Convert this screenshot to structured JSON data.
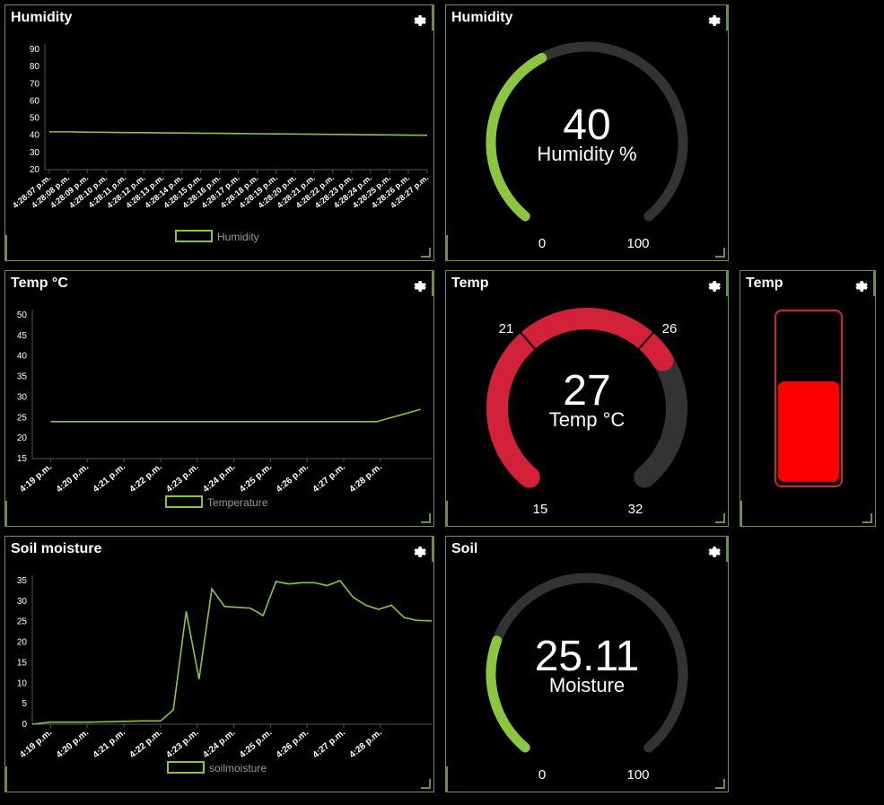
{
  "panels": {
    "humidity_chart": {
      "title": "Humidity"
    },
    "humidity_gauge": {
      "title": "Humidity",
      "value": "40",
      "unit": "Humidity %",
      "min": "0",
      "max": "100",
      "fraction": 0.4
    },
    "temp_chart": {
      "title": "Temp °C"
    },
    "temp_gauge": {
      "title": "Temp",
      "value": "27",
      "unit": "Temp °C",
      "min": "15",
      "max": "32",
      "mark1": "21",
      "mark2": "26",
      "fraction": 0.70588
    },
    "temp_tank": {
      "title": "Temp",
      "level": 0.6
    },
    "soil_chart": {
      "title": "Soil moisture"
    },
    "soil_gauge": {
      "title": "Soil",
      "value": "25.11",
      "unit": "Moisture",
      "min": "0",
      "max": "100",
      "fraction": 0.2511
    }
  },
  "colors": {
    "accent": "#8cc63f",
    "border": "#6a8f4a",
    "track": "#333333",
    "red": "#d4213a",
    "tank_red": "#ff0000"
  },
  "icons": {
    "settings": "gear-icon"
  },
  "chart_data": [
    {
      "type": "line",
      "legend": "Humidity",
      "x": [
        "4:28:07 p.m.",
        "4:28:08 p.m.",
        "4:28:09 p.m.",
        "4:28:10 p.m.",
        "4:28:11 p.m.",
        "4:28:12 p.m.",
        "4:28:13 p.m.",
        "4:28:14 p.m.",
        "4:28:15 p.m.",
        "4:28:16 p.m.",
        "4:28:17 p.m.",
        "4:28:18 p.m.",
        "4:28:19 p.m.",
        "4:28:20 p.m.",
        "4:28:21 p.m.",
        "4:28:22 p.m.",
        "4:28:23 p.m.",
        "4:28:24 p.m.",
        "4:28:25 p.m.",
        "4:28:26 p.m.",
        "4:28:27 p.m."
      ],
      "values": [
        42,
        42,
        41.8,
        41.7,
        41.6,
        41.5,
        41.4,
        41.3,
        41.2,
        41.1,
        41,
        40.9,
        40.8,
        40.7,
        40.6,
        40.5,
        40.4,
        40.3,
        40.2,
        40.1,
        40
      ],
      "yticks": [
        "20",
        "30",
        "40",
        "50",
        "60",
        "70",
        "80",
        "90"
      ],
      "ylim": [
        20,
        90
      ]
    },
    {
      "type": "line",
      "legend": "Temperature",
      "x": [
        "4:19 p.m.",
        "4:20 p.m.",
        "4:21 p.m.",
        "4:22 p.m.",
        "4:23 p.m.",
        "4:24 p.m.",
        "4:25 p.m.",
        "4:26 p.m.",
        "4:27 p.m.",
        "4:28 p.m."
      ],
      "points": [
        [
          0,
          24
        ],
        [
          1,
          24
        ],
        [
          2,
          24
        ],
        [
          3,
          24
        ],
        [
          4,
          24
        ],
        [
          5,
          24
        ],
        [
          6,
          24
        ],
        [
          7,
          24
        ],
        [
          8,
          24
        ],
        [
          8.9,
          24
        ],
        [
          9.3,
          25
        ],
        [
          9.7,
          26
        ],
        [
          10.1,
          27
        ]
      ],
      "yticks": [
        "15",
        "20",
        "25",
        "30",
        "35",
        "40",
        "45",
        "50"
      ],
      "ylim": [
        15,
        50
      ]
    },
    {
      "type": "line",
      "legend": "soilmoisture",
      "x": [
        "4:19 p.m.",
        "4:20 p.m.",
        "4:21 p.m.",
        "4:22 p.m.",
        "4:23 p.m.",
        "4:24 p.m.",
        "4:25 p.m.",
        "4:26 p.m.",
        "4:27 p.m.",
        "4:28 p.m."
      ],
      "points": [
        [
          -0.5,
          0
        ],
        [
          0,
          0.5
        ],
        [
          0.5,
          0.5
        ],
        [
          1,
          0.5
        ],
        [
          1.5,
          0.6
        ],
        [
          2,
          0.7
        ],
        [
          2.5,
          0.8
        ],
        [
          3,
          0.8
        ],
        [
          3.35,
          3.5
        ],
        [
          3.7,
          27.5
        ],
        [
          4.05,
          11
        ],
        [
          4.4,
          33
        ],
        [
          4.75,
          28.7
        ],
        [
          5.1,
          28.5
        ],
        [
          5.45,
          28.3
        ],
        [
          5.8,
          26.5
        ],
        [
          6.15,
          34.8
        ],
        [
          6.5,
          34.2
        ],
        [
          6.85,
          34.5
        ],
        [
          7.2,
          34.5
        ],
        [
          7.55,
          33.8
        ],
        [
          7.9,
          35
        ],
        [
          8.25,
          31
        ],
        [
          8.6,
          29
        ],
        [
          8.95,
          28
        ],
        [
          9.3,
          29
        ],
        [
          9.65,
          26
        ],
        [
          10,
          25.3
        ],
        [
          10.4,
          25.2
        ]
      ],
      "yticks": [
        "0",
        "5",
        "10",
        "15",
        "20",
        "25",
        "30",
        "35"
      ],
      "ylim": [
        0,
        35
      ]
    }
  ]
}
